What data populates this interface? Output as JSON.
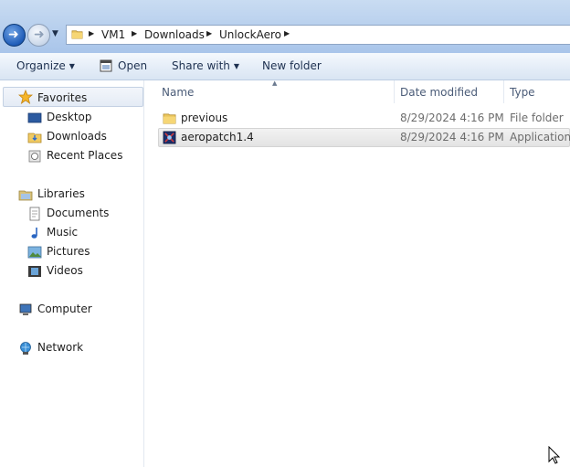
{
  "address": {
    "crumbs": [
      "VM1",
      "Downloads",
      "UnlockAero"
    ]
  },
  "toolbar": {
    "organize_label": "Organize",
    "open_label": "Open",
    "share_label": "Share with",
    "new_folder_label": "New folder"
  },
  "nav": {
    "favorites": "Favorites",
    "desktop": "Desktop",
    "downloads": "Downloads",
    "recent_places": "Recent Places",
    "libraries": "Libraries",
    "documents": "Documents",
    "music": "Music",
    "pictures": "Pictures",
    "videos": "Videos",
    "computer": "Computer",
    "network": "Network"
  },
  "columns": {
    "name": "Name",
    "date_modified": "Date modified",
    "type": "Type"
  },
  "files": [
    {
      "name": "previous",
      "date": "8/29/2024 4:16 PM",
      "type": "File folder",
      "icon": "folder-icon"
    },
    {
      "name": "aeropatch1.4",
      "date": "8/29/2024 4:16 PM",
      "type": "Application",
      "icon": "application-icon",
      "selected": true
    }
  ],
  "colors": {
    "accent": "#1f5cb8",
    "toolbar_text": "#1e3150",
    "header_text": "#4b5c78"
  }
}
